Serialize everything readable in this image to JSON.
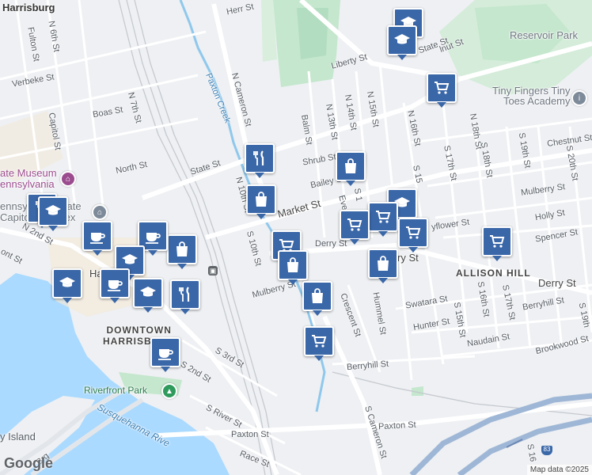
{
  "map": {
    "labels": {
      "harrisburg": "Harrisburg",
      "herr_st": "Herr St",
      "n_6th_st": "N 6th St",
      "fulton_st": "Fulton St",
      "verbeke_st": "Verbeke St",
      "boas_st": "Boas St",
      "n_7th_st": "N 7th St",
      "capitol_st": "Capitol St",
      "north_st": "North St",
      "state_st": "State St",
      "state_st_2": "State St",
      "paxton_creek": "Paxton Creek",
      "n_cameron_st": "N Cameron St",
      "liberty_st": "Liberty St",
      "reservoir_park": "Reservoir Park",
      "tiny_fingers": "Tiny Fingers Tiny\nToes Academy",
      "balm_st": "Balm St",
      "n_13th_st": "N 13th St",
      "n_14th_st": "N 14th St",
      "n_15th_st": "N 15th St",
      "n_16th_st": "N 16th St",
      "s_17th_st": "S 17th St",
      "n_18th_st": "N 18th St",
      "s_18th_st": "S 18th St",
      "s_19th_st": "S 19th St",
      "s_20th_st": "S 20th St",
      "chestnut_st": "Chestnut St",
      "mulberry_st": "Mulberry St",
      "holly_st": "Holly St",
      "spencer_st": "Spencer St",
      "mayflower_st": "yflower St",
      "shrub_st": "Shrub St",
      "bailey_st": "Bailey St",
      "market_st": "Market St",
      "n_10th_st": "N 10th St",
      "s_10th_st": "S 10th St",
      "derry_st": "Derry St",
      "derry_st_2": "Derry St",
      "derry_st_3": "ry St",
      "allison_hill": "ALLISON HILL",
      "state_museum": "ate Museum\nennsylvania",
      "state_capitol": "ennsylvania State\nCapitol Complex",
      "n_2nd_st": "N 2nd St",
      "ont_st": "ont St",
      "mulberry_st_2": "Mulberry St",
      "crescent_st": "Crescent St",
      "hummel_st": "Hummel St",
      "swatara_st": "Swatara St",
      "hunter_st": "Hunter St",
      "s_15th_st": "S 15th St",
      "s_16th_st": "S 16th St",
      "s_17th_st_2": "S 17th St",
      "s_19th_st_2": "S 19th",
      "berryhill_st": "Berryhill St",
      "berryhill_st_2": "Berryhill St",
      "naudain_st": "Naudain St",
      "brookwood_st": "Brookwood St",
      "downtown": "DOWNTOWN\nHARRISBURG",
      "s_3rd_st": "S 3rd St",
      "s_2nd_st": "S 2nd St",
      "riverfront_park": "Riverfront Park",
      "s_river_st": "S River St",
      "paxton_st": "Paxton St",
      "paxton_st_2": "Paxton St",
      "race_st": "Race St",
      "susquehanna": "Susquehanna Rive",
      "island": "y Island",
      "brg": "t Brg",
      "s_cameron_st": "S Cameron St",
      "evergreen": "Eve",
      "s_1": "S 1",
      "s_15": "S 15",
      "ha": "Ha",
      "route_83": "83",
      "s_16": "S 16",
      "lion": "lnut St"
    },
    "logo": "Google",
    "attribution": "Map data ©2025",
    "pins": [
      {
        "icon": "graduation-cap",
        "label": "school"
      },
      {
        "icon": "graduation-cap",
        "label": "school"
      },
      {
        "icon": "shopping-cart",
        "label": "grocery"
      },
      {
        "icon": "fork-knife",
        "label": "restaurant"
      },
      {
        "icon": "shopping-bag",
        "label": "store"
      },
      {
        "icon": "shopping-bag",
        "label": "store"
      },
      {
        "icon": "shopping-cart",
        "label": "grocery"
      },
      {
        "icon": "shopping-bag",
        "label": "store"
      },
      {
        "icon": "graduation-cap",
        "label": "school"
      },
      {
        "icon": "shopping-cart",
        "label": "grocery"
      },
      {
        "icon": "shopping-cart",
        "label": "grocery"
      },
      {
        "icon": "shopping-cart",
        "label": "grocery"
      },
      {
        "icon": "shopping-cart",
        "label": "grocery"
      },
      {
        "icon": "shopping-bag",
        "label": "store"
      },
      {
        "icon": "shopping-cart",
        "label": "grocery"
      },
      {
        "icon": "shopping-bag",
        "label": "store"
      },
      {
        "icon": "fork-knife",
        "label": "restaurant"
      },
      {
        "icon": "shopping-bag",
        "label": "store"
      },
      {
        "icon": "graduation-cap",
        "label": "school"
      },
      {
        "icon": "coffee-cup",
        "label": "cafe"
      },
      {
        "icon": "coffee-cup",
        "label": "cafe"
      },
      {
        "icon": "graduation-cap",
        "label": "school"
      },
      {
        "icon": "coffee-cup",
        "label": "cafe"
      },
      {
        "icon": "graduation-cap",
        "label": "school"
      },
      {
        "icon": "fork-knife",
        "label": "restaurant"
      },
      {
        "icon": "coffee-cup",
        "label": "cafe"
      },
      {
        "icon": "graduation-cap",
        "label": "school"
      }
    ]
  }
}
